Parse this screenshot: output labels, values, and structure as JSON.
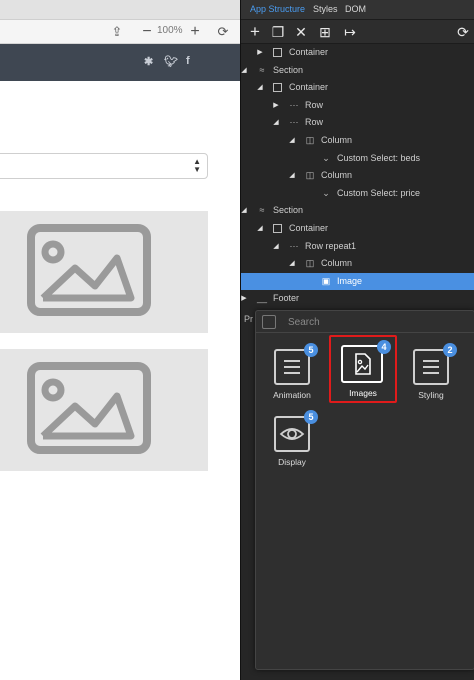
{
  "toolbar": {
    "zoom": "100%"
  },
  "panel": {
    "tabs": [
      "App Structure",
      "Styles",
      "DOM"
    ]
  },
  "tree": [
    {
      "label": "Container",
      "toggle": "▶",
      "icon": "box"
    },
    {
      "label": "Section",
      "toggle": "◢",
      "icon": "section"
    },
    {
      "label": "Container",
      "toggle": "◢",
      "icon": "box"
    },
    {
      "label": "Row",
      "toggle": "▶",
      "icon": "dots"
    },
    {
      "label": "Row",
      "toggle": "◢",
      "icon": "dots"
    },
    {
      "label": "Column",
      "toggle": "◢",
      "icon": "column"
    },
    {
      "label": "Custom Select: beds",
      "toggle": "",
      "icon": "chevron"
    },
    {
      "label": "Column",
      "toggle": "◢",
      "icon": "column"
    },
    {
      "label": "Custom Select: price",
      "toggle": "",
      "icon": "chevron"
    },
    {
      "label": "Section",
      "toggle": "◢",
      "icon": "section"
    },
    {
      "label": "Container",
      "toggle": "◢",
      "icon": "box"
    },
    {
      "label": "Row repeat1",
      "toggle": "◢",
      "icon": "dots"
    },
    {
      "label": "Column",
      "toggle": "◢",
      "icon": "column"
    },
    {
      "label": "Image",
      "toggle": "",
      "icon": "image"
    },
    {
      "label": "Footer",
      "toggle": "▶",
      "icon": "footer"
    }
  ],
  "properties": {
    "label": "Pr"
  },
  "picker": {
    "search_placeholder": "Search",
    "tiles": [
      {
        "label": "Animation",
        "badge": "5"
      },
      {
        "label": "Images",
        "badge": "4"
      },
      {
        "label": "Styling",
        "badge": "2"
      },
      {
        "label": "Display",
        "badge": "5"
      }
    ]
  },
  "colors": {
    "accent": "#4a90e2",
    "highlight": "#e01b1b",
    "header_bg": "#3f4752",
    "panel_bg": "#2b2b2b"
  },
  "icons": {
    "share": "share-icon",
    "zoom_out": "minus-icon",
    "zoom_in": "plus-icon",
    "refresh": "refresh-icon",
    "social": [
      "slack-icon",
      "twitter-icon",
      "facebook-icon"
    ]
  }
}
